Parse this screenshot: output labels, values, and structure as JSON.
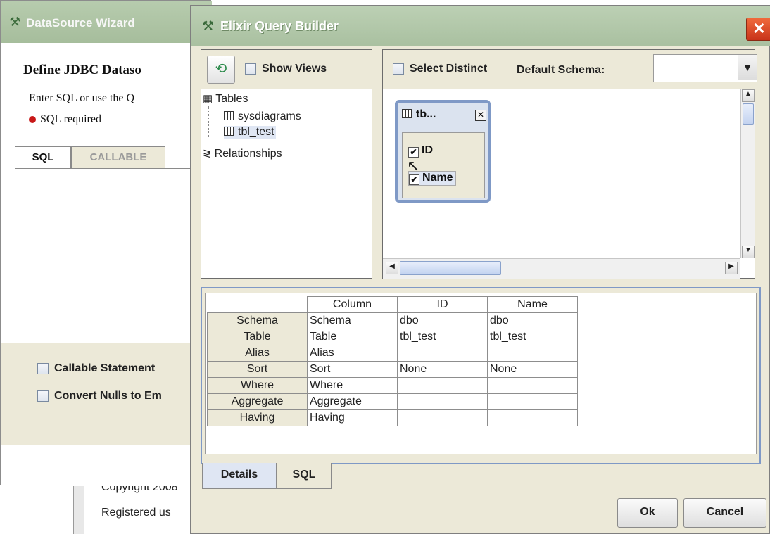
{
  "background_app": {
    "line1": "Copyright 2008",
    "line2": "Registered us"
  },
  "datasource_wizard": {
    "title": "DataSource Wizard",
    "heading": "Define JDBC Dataso",
    "instruction": "Enter SQL or use the Q",
    "required_msg": "SQL required",
    "tabs": [
      "SQL",
      "CALLABLE"
    ],
    "callable_label": "Callable Statement",
    "convert_nulls_label": "Convert Nulls to Em"
  },
  "query_builder": {
    "title": "Elixir Query Builder",
    "close_label": "✕",
    "show_views_label": "Show Views",
    "tree": {
      "tables_label": "Tables",
      "table_items": [
        "sysdiagrams",
        "tbl_test"
      ],
      "selected_item": "tbl_test",
      "relationships_label": "Relationships"
    },
    "select_distinct_label": "Select Distinct",
    "default_schema_label": "Default Schema:",
    "default_schema_value": "",
    "table_card": {
      "title": "tb...",
      "columns": [
        {
          "name": "ID",
          "checked": true
        },
        {
          "name": "Name",
          "checked": true
        }
      ]
    },
    "grid": {
      "headers": [
        "",
        "Column",
        "ID",
        "Name"
      ],
      "rows": [
        [
          "Schema",
          "Schema",
          "dbo",
          "dbo"
        ],
        [
          "Table",
          "Table",
          "tbl_test",
          "tbl_test"
        ],
        [
          "Alias",
          "Alias",
          "",
          ""
        ],
        [
          "Sort",
          "Sort",
          "None",
          "None"
        ],
        [
          "Where",
          "Where",
          "",
          ""
        ],
        [
          "Aggregate",
          "Aggregate",
          "",
          ""
        ],
        [
          "Having",
          "Having",
          "",
          ""
        ]
      ]
    },
    "bottom_tabs": [
      "Details",
      "SQL"
    ],
    "active_bottom_tab": "Details",
    "ok_label": "Ok",
    "cancel_label": "Cancel"
  }
}
